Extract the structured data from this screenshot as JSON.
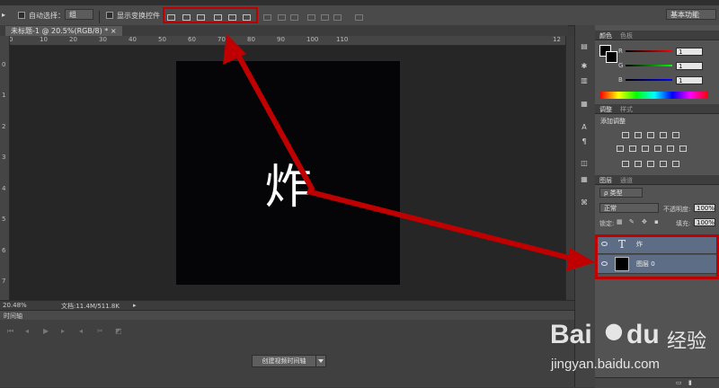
{
  "options_bar": {
    "auto_select_label": "自动选择：",
    "auto_select_value": "组",
    "show_transform_label": "显示变换控件",
    "workspace_label": "基本功能"
  },
  "document": {
    "tab_title": "未标题-1 @ 20.5%(RGB/8) *",
    "tab_close": "×",
    "canvas_text": "炸",
    "canvas_color": "#050407",
    "ruler_h": [
      "0",
      "10",
      "20",
      "30",
      "40",
      "50",
      "60",
      "70",
      "80",
      "90",
      "100",
      "110",
      "12"
    ],
    "ruler_v": [
      "0",
      "1",
      "2",
      "3",
      "4",
      "5",
      "6",
      "7"
    ]
  },
  "status": {
    "zoom": "20.48%",
    "doc_size": "文档:11.4M/511.8K"
  },
  "timeline": {
    "title": "时间轴",
    "create_button": "创建视频时间轴"
  },
  "color_panel": {
    "tab_active": "颜色",
    "tab_inactive": "色板",
    "channels": [
      {
        "label": "R",
        "value": "1",
        "color": "#d02020"
      },
      {
        "label": "G",
        "value": "1",
        "color": "#20a020"
      },
      {
        "label": "B",
        "value": "1",
        "color": "#2040d0"
      }
    ]
  },
  "adjust_panel": {
    "tab_active": "调整",
    "tab_inactive": "样式",
    "add_label": "添加调整"
  },
  "layers_panel": {
    "tab_active": "图层",
    "tab_inactive": "通道",
    "kind_filter": "ρ 类型",
    "blend_mode": "正常",
    "opacity_label": "不透明度:",
    "opacity_value": "100%",
    "lock_label": "锁定:",
    "fill_label": "填充:",
    "fill_value": "100%",
    "layers": [
      {
        "name": "炸",
        "type": "text",
        "thumb": "T"
      },
      {
        "name": "图层 0",
        "type": "pixel",
        "thumb": ""
      }
    ]
  },
  "watermark": {
    "brand_en": "Bai",
    "brand_du": "du",
    "brand_cn": "经验",
    "url": "jingyan.baidu.com"
  },
  "accent": {
    "annotation_red": "#c00000",
    "layer_selected": "#5d6d86"
  }
}
